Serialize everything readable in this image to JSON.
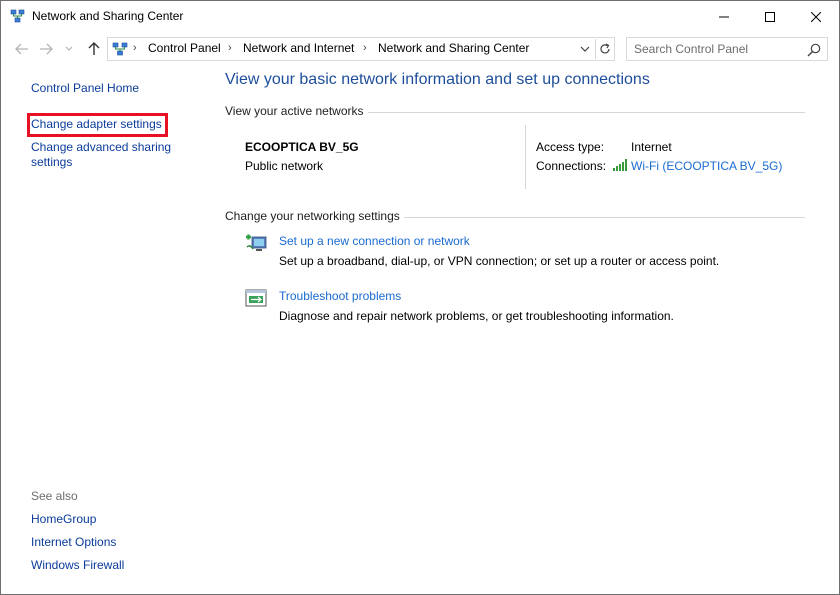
{
  "window": {
    "title": "Network and Sharing Center"
  },
  "address": {
    "crumbs": [
      "Control Panel",
      "Network and Internet",
      "Network and Sharing Center"
    ],
    "search_placeholder": "Search Control Panel"
  },
  "sidebar": {
    "home": "Control Panel Home",
    "adapter": "Change adapter settings",
    "advanced_line1": "Change advanced sharing",
    "advanced_line2": "settings",
    "see_also": "See also",
    "see_also_items": [
      "HomeGroup",
      "Internet Options",
      "Windows Firewall"
    ]
  },
  "main": {
    "title": "View your basic network information and set up connections",
    "active_networks_heading": "View your active networks",
    "network_name": "ECOOPTICA BV_5G",
    "network_category": "Public network",
    "access_type_label": "Access type:",
    "access_type_value": "Internet",
    "connections_label": "Connections:",
    "connections_value": "Wi-Fi (ECOOPTICA BV_5G)",
    "change_settings_heading": "Change your networking settings",
    "tasks": [
      {
        "title": "Set up a new connection or network",
        "desc": "Set up a broadband, dial-up, or VPN connection; or set up a router or access point."
      },
      {
        "title": "Troubleshoot problems",
        "desc": "Diagnose and repair network problems, or get troubleshooting information."
      }
    ]
  },
  "colors": {
    "link": "#1a6bd0",
    "nav_link": "#0b3c9a",
    "title_blue": "#1e4e9b",
    "highlight_box": "#e81123"
  },
  "icons": {
    "title": "network-center-icon",
    "search": "search-icon",
    "wifi": "wifi-signal-icon",
    "new_connection": "new-connection-icon",
    "troubleshoot": "troubleshoot-icon"
  }
}
